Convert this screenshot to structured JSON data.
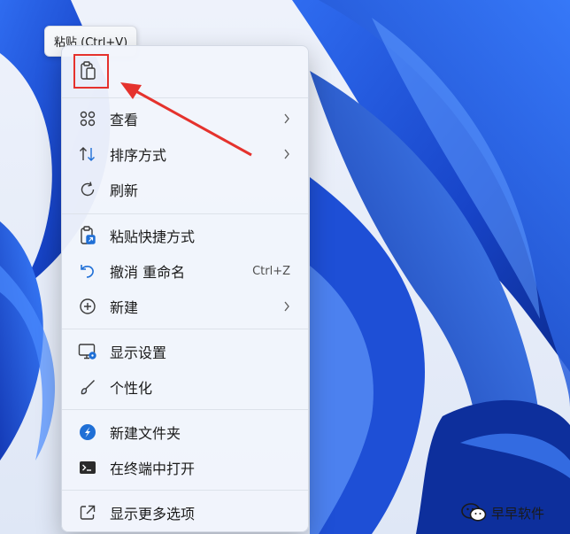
{
  "tooltip": "粘贴 (Ctrl+V)",
  "menu": {
    "paste_icon": "clipboard-icon",
    "items": [
      {
        "id": "view",
        "label": "查看",
        "icon": "grid-icon",
        "submenu": true
      },
      {
        "id": "sort",
        "label": "排序方式",
        "icon": "sort-arrows-icon",
        "submenu": true
      },
      {
        "id": "refresh",
        "label": "刷新",
        "icon": "refresh-icon"
      },
      {
        "id": "paste-shortcut",
        "label": "粘贴快捷方式",
        "icon": "paste-shortcut-icon"
      },
      {
        "id": "undo-rename",
        "label": "撤消 重命名",
        "icon": "undo-icon",
        "shortcut": "Ctrl+Z"
      },
      {
        "id": "new",
        "label": "新建",
        "icon": "plus-circle-icon",
        "submenu": true
      },
      {
        "id": "display-settings",
        "label": "显示设置",
        "icon": "monitor-settings-icon"
      },
      {
        "id": "personalize",
        "label": "个性化",
        "icon": "brush-icon"
      },
      {
        "id": "new-folder",
        "label": "新建文件夹",
        "icon": "compass-icon"
      },
      {
        "id": "terminal",
        "label": "在终端中打开",
        "icon": "terminal-icon"
      },
      {
        "id": "more-options",
        "label": "显示更多选项",
        "icon": "expand-icon"
      }
    ]
  },
  "watermark": {
    "text": "早早软件",
    "icon": "wechat-icon"
  },
  "colors": {
    "annotation_red": "#e5322d",
    "wallpaper_blue": "#1f55e0",
    "accent": "#1f6fd6"
  }
}
